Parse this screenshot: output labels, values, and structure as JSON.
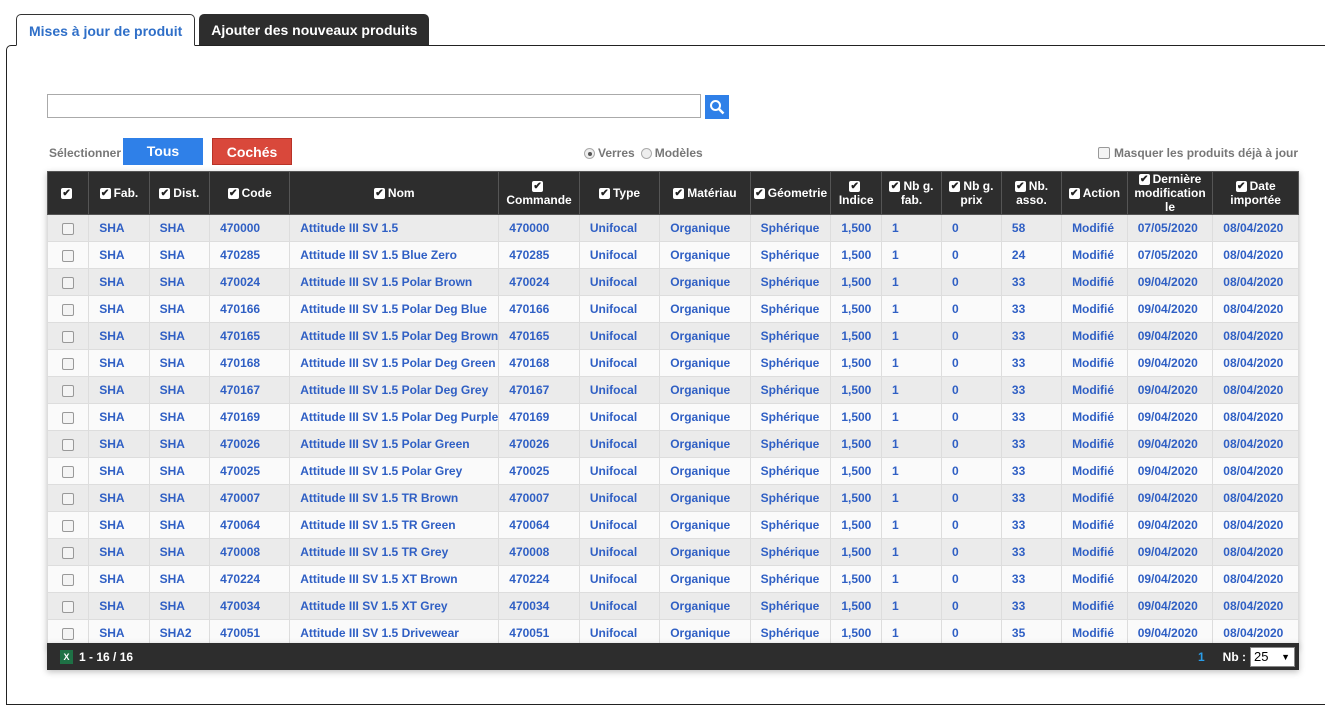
{
  "tabs": [
    {
      "label": "Mises à jour de produit",
      "active": true
    },
    {
      "label": "Ajouter des nouveaux produits",
      "active": false
    }
  ],
  "search": {
    "value": "",
    "placeholder": ""
  },
  "select_label": "Sélectionner",
  "buttons": {
    "all": "Tous",
    "checked": "Cochés"
  },
  "radios": [
    {
      "label": "Verres",
      "checked": true
    },
    {
      "label": "Modèles",
      "checked": false
    }
  ],
  "hide_uptodate": {
    "label": "Masquer les produits déjà à jour",
    "checked": false
  },
  "columns": [
    [
      "Fab."
    ],
    [
      "Dist."
    ],
    [
      "Code"
    ],
    [
      "Nom"
    ],
    [
      "Commande"
    ],
    [
      "Type"
    ],
    [
      "Matériau"
    ],
    [
      "Géometrie"
    ],
    [
      "Indice"
    ],
    [
      "Nb g.",
      "fab."
    ],
    [
      "Nb g.",
      "prix"
    ],
    [
      "Nb.",
      "asso."
    ],
    [
      "Action"
    ],
    [
      "Dernière",
      "modification le"
    ],
    [
      "Date",
      "importée"
    ]
  ],
  "rows": [
    [
      "SHA",
      "SHA",
      "470000",
      "Attitude III SV 1.5",
      "470000",
      "Unifocal",
      "Organique",
      "Sphérique",
      "1,500",
      "1",
      "0",
      "58",
      "Modifié",
      "07/05/2020",
      "08/04/2020"
    ],
    [
      "SHA",
      "SHA",
      "470285",
      "Attitude III SV 1.5 Blue Zero",
      "470285",
      "Unifocal",
      "Organique",
      "Sphérique",
      "1,500",
      "1",
      "0",
      "24",
      "Modifié",
      "07/05/2020",
      "08/04/2020"
    ],
    [
      "SHA",
      "SHA",
      "470024",
      "Attitude III SV 1.5 Polar Brown",
      "470024",
      "Unifocal",
      "Organique",
      "Sphérique",
      "1,500",
      "1",
      "0",
      "33",
      "Modifié",
      "09/04/2020",
      "08/04/2020"
    ],
    [
      "SHA",
      "SHA",
      "470166",
      "Attitude III SV 1.5 Polar Deg Blue",
      "470166",
      "Unifocal",
      "Organique",
      "Sphérique",
      "1,500",
      "1",
      "0",
      "33",
      "Modifié",
      "09/04/2020",
      "08/04/2020"
    ],
    [
      "SHA",
      "SHA",
      "470165",
      "Attitude III SV 1.5 Polar Deg Brown",
      "470165",
      "Unifocal",
      "Organique",
      "Sphérique",
      "1,500",
      "1",
      "0",
      "33",
      "Modifié",
      "09/04/2020",
      "08/04/2020"
    ],
    [
      "SHA",
      "SHA",
      "470168",
      "Attitude III SV 1.5 Polar Deg Green",
      "470168",
      "Unifocal",
      "Organique",
      "Sphérique",
      "1,500",
      "1",
      "0",
      "33",
      "Modifié",
      "09/04/2020",
      "08/04/2020"
    ],
    [
      "SHA",
      "SHA",
      "470167",
      "Attitude III SV 1.5 Polar Deg Grey",
      "470167",
      "Unifocal",
      "Organique",
      "Sphérique",
      "1,500",
      "1",
      "0",
      "33",
      "Modifié",
      "09/04/2020",
      "08/04/2020"
    ],
    [
      "SHA",
      "SHA",
      "470169",
      "Attitude III SV 1.5 Polar Deg Purple",
      "470169",
      "Unifocal",
      "Organique",
      "Sphérique",
      "1,500",
      "1",
      "0",
      "33",
      "Modifié",
      "09/04/2020",
      "08/04/2020"
    ],
    [
      "SHA",
      "SHA",
      "470026",
      "Attitude III SV 1.5 Polar Green",
      "470026",
      "Unifocal",
      "Organique",
      "Sphérique",
      "1,500",
      "1",
      "0",
      "33",
      "Modifié",
      "09/04/2020",
      "08/04/2020"
    ],
    [
      "SHA",
      "SHA",
      "470025",
      "Attitude III SV 1.5 Polar Grey",
      "470025",
      "Unifocal",
      "Organique",
      "Sphérique",
      "1,500",
      "1",
      "0",
      "33",
      "Modifié",
      "09/04/2020",
      "08/04/2020"
    ],
    [
      "SHA",
      "SHA",
      "470007",
      "Attitude III SV 1.5 TR Brown",
      "470007",
      "Unifocal",
      "Organique",
      "Sphérique",
      "1,500",
      "1",
      "0",
      "33",
      "Modifié",
      "09/04/2020",
      "08/04/2020"
    ],
    [
      "SHA",
      "SHA",
      "470064",
      "Attitude III SV 1.5 TR Green",
      "470064",
      "Unifocal",
      "Organique",
      "Sphérique",
      "1,500",
      "1",
      "0",
      "33",
      "Modifié",
      "09/04/2020",
      "08/04/2020"
    ],
    [
      "SHA",
      "SHA",
      "470008",
      "Attitude III SV 1.5 TR Grey",
      "470008",
      "Unifocal",
      "Organique",
      "Sphérique",
      "1,500",
      "1",
      "0",
      "33",
      "Modifié",
      "09/04/2020",
      "08/04/2020"
    ],
    [
      "SHA",
      "SHA",
      "470224",
      "Attitude III SV 1.5 XT Brown",
      "470224",
      "Unifocal",
      "Organique",
      "Sphérique",
      "1,500",
      "1",
      "0",
      "33",
      "Modifié",
      "09/04/2020",
      "08/04/2020"
    ],
    [
      "SHA",
      "SHA",
      "470034",
      "Attitude III SV 1.5 XT Grey",
      "470034",
      "Unifocal",
      "Organique",
      "Sphérique",
      "1,500",
      "1",
      "0",
      "33",
      "Modifié",
      "09/04/2020",
      "08/04/2020"
    ],
    [
      "SHA",
      "SHA2",
      "470051",
      "Attitude III SV 1.5 Drivewear",
      "470051",
      "Unifocal",
      "Organique",
      "Sphérique",
      "1,500",
      "1",
      "0",
      "35",
      "Modifié",
      "09/04/2020",
      "08/04/2020"
    ]
  ],
  "footer": {
    "range": "1 - 16 / 16",
    "page": "1",
    "nb_label": "Nb :",
    "page_size": "25",
    "export_icon": "excel-icon"
  },
  "colors": {
    "accent": "#2f80e8",
    "danger": "#d9483b",
    "link": "#2f5fc4",
    "header_bg": "#2d2d2d"
  }
}
